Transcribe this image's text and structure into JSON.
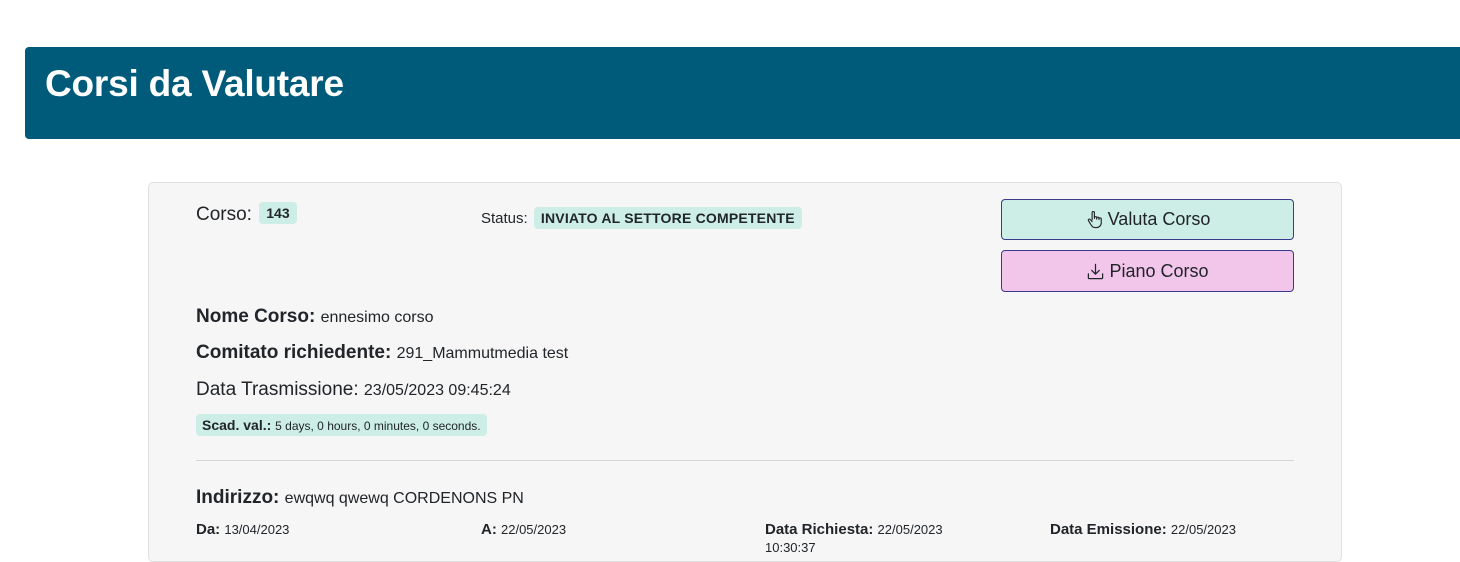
{
  "header": {
    "title": "Corsi da Valutare",
    "background": "#005b7b"
  },
  "course": {
    "corso_label": "Corso:",
    "corso_id": "143",
    "status_label": "Status:",
    "status_value": "INVIATO AL SETTORE COMPETENTE",
    "nome_label": "Nome Corso:",
    "nome_value": "ennesimo corso",
    "comitato_label": "Comitato richiedente:",
    "comitato_value": "291_Mammutmedia test",
    "trasmissione_label": "Data Trasmissione:",
    "trasmissione_value": "23/05/2023 09:45:24",
    "scadenza_label": "Scad. val.:",
    "scadenza_value": "5 days, 0 hours, 0 minutes, 0 seconds.",
    "indirizzo_label": "Indirizzo:",
    "indirizzo_value": "ewqwq qwewq CORDENONS PN",
    "da_label": "Da:",
    "da_value": "13/04/2023",
    "a_label": "A:",
    "a_value": "22/05/2023",
    "richiesta_label": "Data Richiesta:",
    "richiesta_value": "22/05/2023",
    "richiesta_time": "10:30:37",
    "emissione_label": "Data Emissione:",
    "emissione_value": "22/05/2023"
  },
  "buttons": {
    "valuta_label": "Valuta Corso",
    "valuta_icon": "hand-pointer-icon",
    "valuta_color": "#cdeee6",
    "piano_label": "Piano Corso",
    "piano_icon": "download-icon",
    "piano_color": "#f2c6ea"
  },
  "colors": {
    "badge": "#cdeee6",
    "card": "#f6f6f6"
  }
}
